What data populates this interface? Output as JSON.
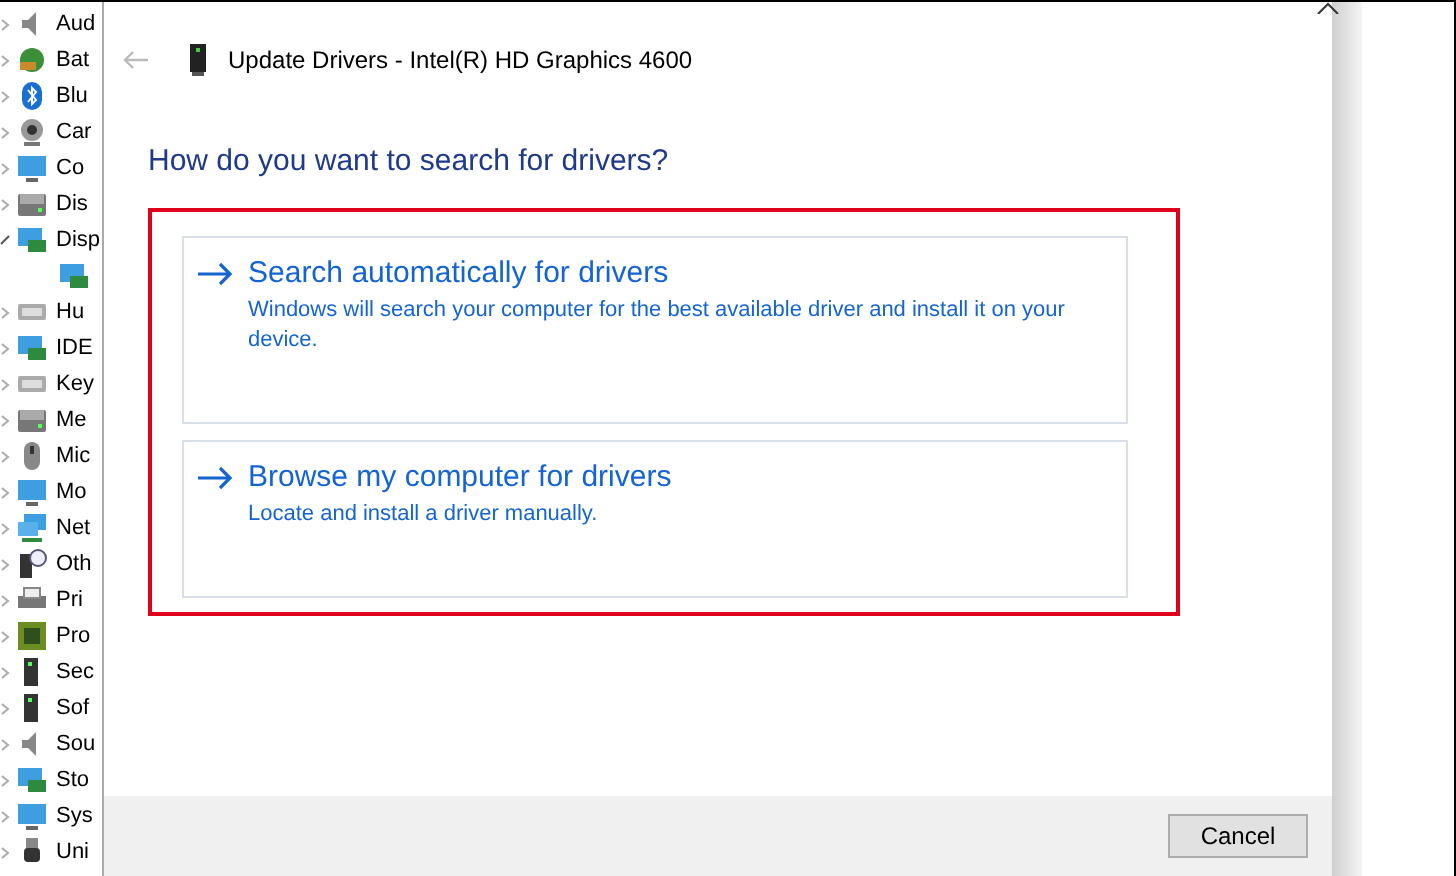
{
  "sidebar": {
    "items": [
      {
        "label": "Aud",
        "expanded": false
      },
      {
        "label": "Bat",
        "expanded": false
      },
      {
        "label": "Blu",
        "expanded": false
      },
      {
        "label": "Car",
        "expanded": false
      },
      {
        "label": "Co",
        "expanded": false
      },
      {
        "label": "Dis",
        "expanded": false
      },
      {
        "label": "Disp",
        "expanded": true,
        "children": [
          {
            "kind": "device"
          }
        ]
      },
      {
        "label": "Hu",
        "expanded": false
      },
      {
        "label": "IDE",
        "expanded": false
      },
      {
        "label": "Key",
        "expanded": false
      },
      {
        "label": "Me",
        "expanded": false
      },
      {
        "label": "Mic",
        "expanded": false
      },
      {
        "label": "Mo",
        "expanded": false
      },
      {
        "label": "Net",
        "expanded": false
      },
      {
        "label": "Oth",
        "expanded": false
      },
      {
        "label": "Pri",
        "expanded": false
      },
      {
        "label": "Pro",
        "expanded": false
      },
      {
        "label": "Sec",
        "expanded": false
      },
      {
        "label": "Sof",
        "expanded": false
      },
      {
        "label": "Sou",
        "expanded": false
      },
      {
        "label": "Sto",
        "expanded": false
      },
      {
        "label": "Sys",
        "expanded": false
      },
      {
        "label": "Uni",
        "expanded": false
      }
    ]
  },
  "dialog": {
    "title": "Update Drivers - Intel(R) HD Graphics 4600",
    "heading": "How do you want to search for drivers?",
    "options": [
      {
        "title": "Search automatically for drivers",
        "description": "Windows will search your computer for the best available driver and install it on your device."
      },
      {
        "title": "Browse my computer for drivers",
        "description": "Locate and install a driver manually."
      }
    ],
    "buttons": [
      "Cancel"
    ]
  }
}
